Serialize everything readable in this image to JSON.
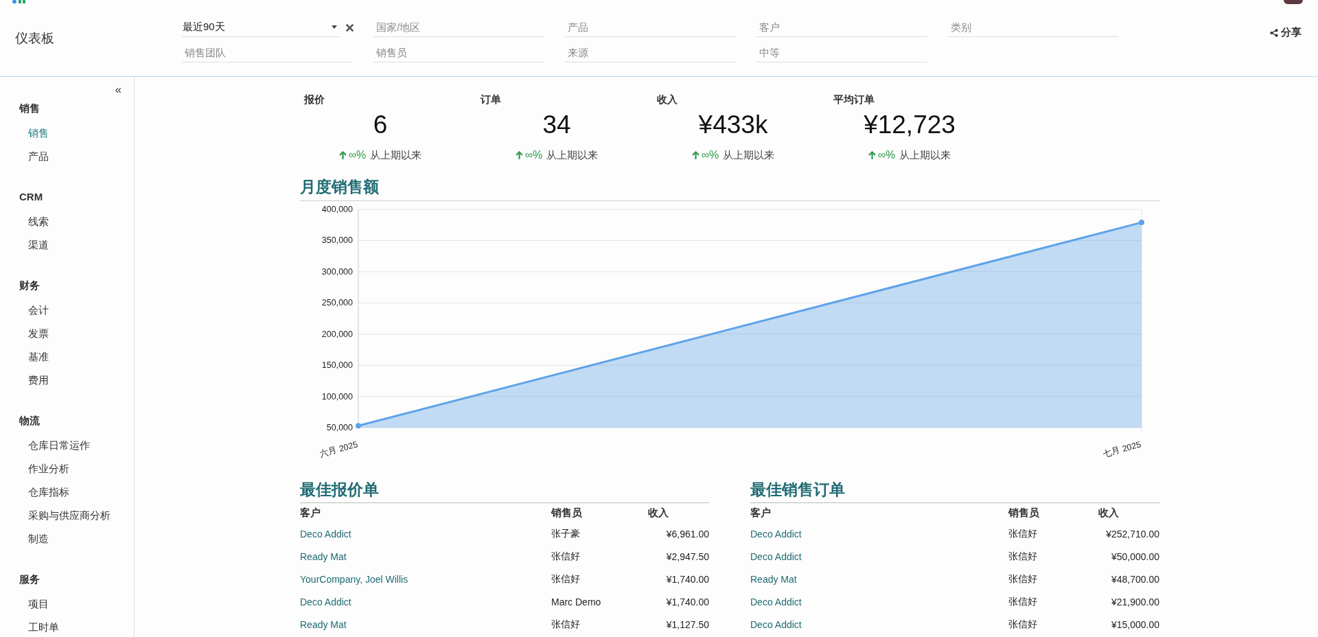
{
  "header": {
    "title": "仪表板",
    "share": "分享",
    "filters": [
      {
        "kind": "select",
        "value": "最近90天",
        "clearable": true
      },
      {
        "kind": "text",
        "placeholder": "国家/地区"
      },
      {
        "kind": "text",
        "placeholder": "产品"
      },
      {
        "kind": "text",
        "placeholder": "客户"
      },
      {
        "kind": "text",
        "placeholder": "类别"
      },
      {
        "kind": "text",
        "placeholder": "销售团队"
      },
      {
        "kind": "text",
        "placeholder": "销售员"
      },
      {
        "kind": "text",
        "placeholder": "来源"
      },
      {
        "kind": "text",
        "placeholder": "中等"
      }
    ]
  },
  "sidebar": {
    "collapse": "«",
    "sections": [
      {
        "title": "销售",
        "items": [
          {
            "label": "销售",
            "selected": true
          },
          {
            "label": "产品",
            "selected": false
          }
        ]
      },
      {
        "title": "CRM",
        "items": [
          {
            "label": "线索",
            "selected": false
          },
          {
            "label": "渠道",
            "selected": false
          }
        ]
      },
      {
        "title": "财务",
        "items": [
          {
            "label": "会计",
            "selected": false
          },
          {
            "label": "发票",
            "selected": false
          },
          {
            "label": "基准",
            "selected": false
          },
          {
            "label": "费用",
            "selected": false
          }
        ]
      },
      {
        "title": "物流",
        "items": [
          {
            "label": "仓库日常运作",
            "selected": false
          },
          {
            "label": "作业分析",
            "selected": false
          },
          {
            "label": "仓库指标",
            "selected": false
          },
          {
            "label": "采购与供应商分析",
            "selected": false
          },
          {
            "label": "制造",
            "selected": false
          }
        ]
      },
      {
        "title": "服务",
        "items": [
          {
            "label": "项目",
            "selected": false
          },
          {
            "label": "工时单",
            "selected": false
          }
        ]
      }
    ]
  },
  "kpis": [
    {
      "label": "报价",
      "value": "6",
      "change": "∞%",
      "since": "从上期以来"
    },
    {
      "label": "订单",
      "value": "34",
      "change": "∞%",
      "since": "从上期以来"
    },
    {
      "label": "收入",
      "value": "¥433k",
      "change": "∞%",
      "since": "从上期以来"
    },
    {
      "label": "平均订单",
      "value": "¥12,723",
      "change": "∞%",
      "since": "从上期以来"
    }
  ],
  "monthly_sales": {
    "title": "月度销售额",
    "chart_data": {
      "type": "area",
      "categories": [
        "六月 2025",
        "七月 2025"
      ],
      "series": [
        {
          "color": "#5ea3e8",
          "values": [
            53000,
            379000
          ]
        }
      ],
      "ylim": [
        50000,
        400000
      ],
      "yticks": [
        {
          "value": 50000,
          "label": "50,000"
        },
        {
          "value": 100000,
          "label": "100,000"
        },
        {
          "value": 150000,
          "label": "150,000"
        },
        {
          "value": 200000,
          "label": "200,000"
        },
        {
          "value": 250000,
          "label": "250,000"
        },
        {
          "value": 300000,
          "label": "300,000"
        },
        {
          "value": 350000,
          "label": "350,000"
        },
        {
          "value": 400000,
          "label": "400,000"
        }
      ]
    }
  },
  "tables": [
    {
      "title": "最佳报价单",
      "columns": [
        "客户",
        "销售员",
        "收入"
      ],
      "rows": [
        [
          "Deco Addict",
          "张子豪",
          "¥6,961.00"
        ],
        [
          "Ready Mat",
          "张信好",
          "¥2,947.50"
        ],
        [
          "YourCompany, Joel Willis",
          "张信好",
          "¥1,740.00"
        ],
        [
          "Deco Addict",
          "Marc Demo",
          "¥1,740.00"
        ],
        [
          "Ready Mat",
          "张信好",
          "¥1,127.50"
        ]
      ]
    },
    {
      "title": "最佳销售订单",
      "columns": [
        "客户",
        "销售员",
        "收入"
      ],
      "rows": [
        [
          "Deco Addict",
          "张信好",
          "¥252,710.00"
        ],
        [
          "Deco Addict",
          "张信好",
          "¥50,000.00"
        ],
        [
          "Ready Mat",
          "张信好",
          "¥48,700.00"
        ],
        [
          "Deco Addict",
          "张信好",
          "¥21,900.00"
        ],
        [
          "Deco Addict",
          "张信好",
          "¥15,000.00"
        ]
      ]
    }
  ]
}
